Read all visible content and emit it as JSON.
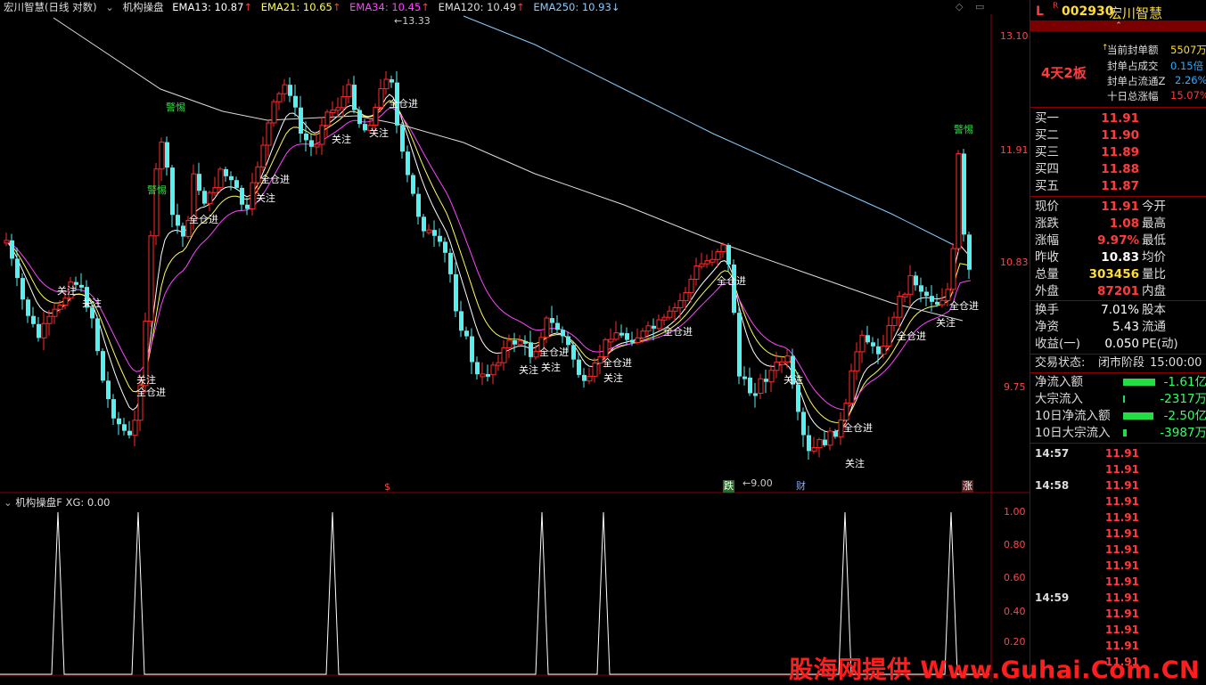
{
  "header": {
    "stock_title": "宏川智慧(日线 对数)",
    "indicator_name": "机构操盘",
    "ema13": "EMA13: 10.87",
    "ema21": "EMA21: 10.65",
    "ema34": "EMA34: 10.45",
    "ema120": "EMA120: 10.49",
    "ema250": "EMA250: 10.93"
  },
  "price_axis": [
    "13.10",
    "11.91",
    "10.83",
    "9.75"
  ],
  "high_mark": "13.33",
  "low_mark": "9.00",
  "sub_panel": {
    "title": "机构操盘F",
    "xg": "XG: 0.00",
    "ticks": [
      "1.00",
      "0.80",
      "0.60",
      "0.40",
      "0.20"
    ]
  },
  "chart_labels": {
    "buy": "全仓进",
    "watch": "关注",
    "warn": "警惕"
  },
  "bottom_flags": {
    "s": "$",
    "die": "跌",
    "cai": "财",
    "zhang": "涨"
  },
  "colors": {
    "up": "#ff2a2a",
    "down": "#55f0f0",
    "ema13": "#ffffff",
    "ema21": "#ffff55",
    "ema34": "#ff44ff",
    "ema120": "#dddddd",
    "ema250": "#88ccff"
  },
  "sidebar": {
    "market_flag": "L",
    "r_flag": "R",
    "code": "002930",
    "name": "宏川智慧",
    "board_tag": "4天2板",
    "seal_amount_label": "当前封单额",
    "seal_amount": "5507万",
    "seal_vol_label": "封单占成交",
    "seal_vol": "0.15倍",
    "seal_float_label": "封单占流通Z",
    "seal_float": "2.26%",
    "ten_day_label": "十日总涨幅",
    "ten_day": "15.07%",
    "bids": [
      {
        "label": "买一",
        "price": "11.91"
      },
      {
        "label": "买二",
        "price": "11.90"
      },
      {
        "label": "买三",
        "price": "11.89"
      },
      {
        "label": "买四",
        "price": "11.88"
      },
      {
        "label": "买五",
        "price": "11.87"
      }
    ],
    "quote": [
      {
        "l1": "现价",
        "v1": "11.91",
        "l2": "今开"
      },
      {
        "l1": "涨跌",
        "v1": "1.08",
        "l2": "最高"
      },
      {
        "l1": "涨幅",
        "v1": "9.97%",
        "l2": "最低"
      },
      {
        "l1": "昨收",
        "v1": "10.83",
        "l2": "均价"
      },
      {
        "l1": "总量",
        "v1": "303456",
        "l2": "量比"
      },
      {
        "l1": "外盘",
        "v1": "87201",
        "l2": "内盘"
      }
    ],
    "stats": [
      {
        "l1": "换手",
        "v1": "7.01%",
        "l2": "股本"
      },
      {
        "l1": "净资",
        "v1": "5.43",
        "l2": "流通"
      },
      {
        "l1": "收益(一)",
        "v1": "0.050",
        "l2": "PE(动)"
      }
    ],
    "trade_status_label": "交易状态:",
    "trade_status": "闭市阶段",
    "trade_time": "15:00:00",
    "flows": [
      {
        "label": "净流入额",
        "value": "-1.61亿"
      },
      {
        "label": "大宗流入",
        "value": "-2317万"
      },
      {
        "label": "10日净流入额",
        "value": "-2.50亿"
      },
      {
        "label": "10日大宗流入",
        "value": "-3987万"
      }
    ],
    "ticks": [
      {
        "time": "14:57",
        "price": "11.91"
      },
      {
        "time": "",
        "price": "11.91"
      },
      {
        "time": "14:58",
        "price": "11.91"
      },
      {
        "time": "",
        "price": "11.91"
      },
      {
        "time": "",
        "price": "11.91"
      },
      {
        "time": "",
        "price": "11.91"
      },
      {
        "time": "",
        "price": "11.91"
      },
      {
        "time": "",
        "price": "11.91"
      },
      {
        "time": "",
        "price": "11.91"
      },
      {
        "time": "14:59",
        "price": "11.91"
      },
      {
        "time": "",
        "price": "11.91"
      },
      {
        "time": "",
        "price": "11.91"
      },
      {
        "time": "",
        "price": "11.91"
      },
      {
        "time": "",
        "price": "11.91"
      }
    ]
  },
  "watermark": "股海网提供 Www.Guhai.Com.CN"
}
